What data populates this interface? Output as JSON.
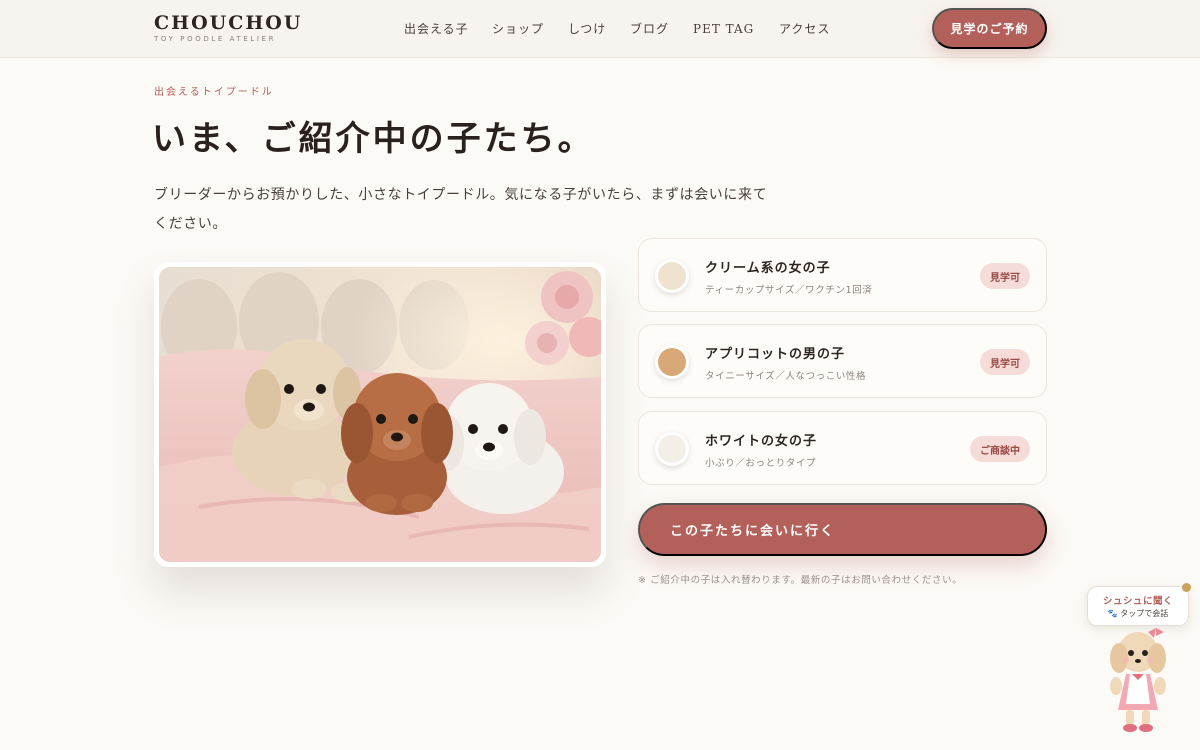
{
  "brand": {
    "name": "CHOUCHOU",
    "tagline": "TOY POODLE ATELIER"
  },
  "nav": {
    "items": [
      "出会える子",
      "ショップ",
      "しつけ",
      "ブログ",
      "PET TAG",
      "アクセス"
    ],
    "cta_label": "見学のご予約"
  },
  "hero": {
    "eyebrow": "出会えるトイプードル",
    "title": "いま、ご紹介中の子たち。",
    "lead": "ブリーダーからお預かりした、小さなトイプードル。気になる子がいたら、まずは会いに来てください。"
  },
  "photo": {
    "alt": "three toy poodle puppies on a pink blanket"
  },
  "puppies": [
    {
      "name": "クリーム系の女の子",
      "detail": "ティーカップサイズ／ワクチン1回済",
      "status": "見学可",
      "color": "#efe3cf"
    },
    {
      "name": "アプリコットの男の子",
      "detail": "タイニーサイズ／人なつっこい性格",
      "status": "見学可",
      "color": "#d9a877"
    },
    {
      "name": "ホワイトの女の子",
      "detail": "小ぶり／おっとりタイプ",
      "status": "ご商談中",
      "color": "#f3eee7"
    }
  ],
  "cta": {
    "meet_label": "この子たちに会いに行く",
    "note": "※ ご紹介中の子は入れ替わります。最新の子はお問い合わせください。"
  },
  "chat": {
    "title": "シュシュに聞く",
    "subtitle": "🐾 タップで会話",
    "icon": "paw-icon"
  },
  "colors": {
    "accent": "#b4605a",
    "background": "#fcfaf6",
    "badge_bg": "#f5dcd9"
  }
}
